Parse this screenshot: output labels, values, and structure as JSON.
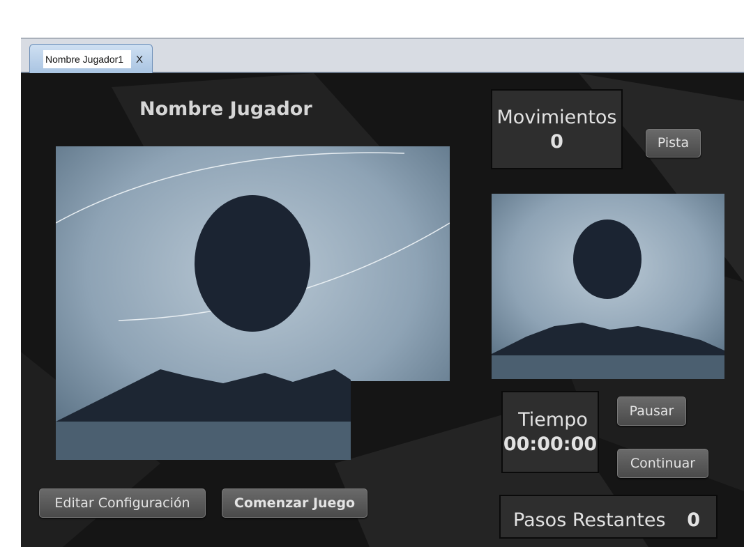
{
  "tab": {
    "title": "Nombre Jugador1",
    "close": "X"
  },
  "player_name": "Nombre Jugador",
  "moves": {
    "label": "Movimientos",
    "value": "0"
  },
  "buttons": {
    "hint": "Pista",
    "pause": "Pausar",
    "resume": "Continuar",
    "edit": "Editar Configuración",
    "start": "Comenzar Juego"
  },
  "time": {
    "label": "Tiempo",
    "value": "00:00:00"
  },
  "remaining": {
    "label": "Pasos Restantes",
    "value": "0"
  }
}
